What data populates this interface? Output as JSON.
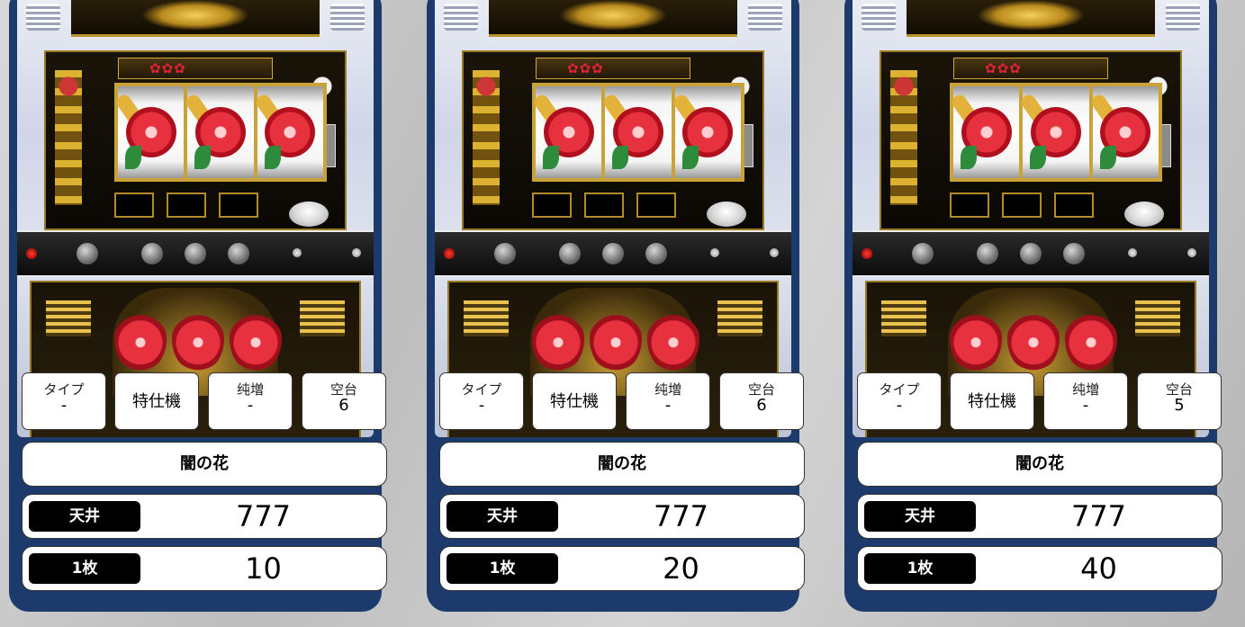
{
  "cards": [
    {
      "stats": [
        {
          "label": "タイプ",
          "value": "-"
        },
        {
          "label": "",
          "value": "特仕機"
        },
        {
          "label": "纯増",
          "value": "-"
        },
        {
          "label": "空台",
          "value": "6"
        }
      ],
      "name": "闇の花",
      "ceiling_label": "天井",
      "ceiling_value": "777",
      "coin_label": "1枚",
      "coin_value": "10"
    },
    {
      "stats": [
        {
          "label": "タイプ",
          "value": "-"
        },
        {
          "label": "",
          "value": "特仕機"
        },
        {
          "label": "纯増",
          "value": "-"
        },
        {
          "label": "空台",
          "value": "6"
        }
      ],
      "name": "闇の花",
      "ceiling_label": "天井",
      "ceiling_value": "777",
      "coin_label": "1枚",
      "coin_value": "20"
    },
    {
      "stats": [
        {
          "label": "タイプ",
          "value": "-"
        },
        {
          "label": "",
          "value": "特仕機"
        },
        {
          "label": "纯増",
          "value": "-"
        },
        {
          "label": "空台",
          "value": "5"
        }
      ],
      "name": "闇の花",
      "ceiling_label": "天井",
      "ceiling_value": "777",
      "coin_label": "1枚",
      "coin_value": "40"
    }
  ],
  "machine_art": {
    "icon": "slot-machine-image",
    "reel_symbol": "hibiscus-icon"
  },
  "colors": {
    "card_border": "#1c3a6b",
    "tag_background": "#000000",
    "box_background": "#ffffff"
  }
}
